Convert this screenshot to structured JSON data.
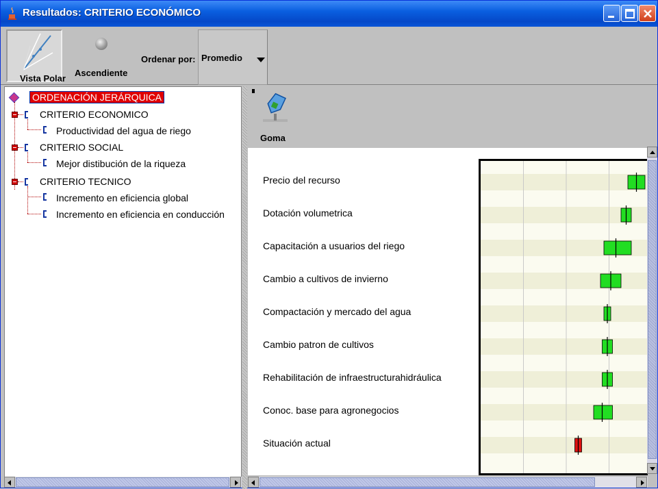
{
  "window": {
    "title": "Resultados: CRITERIO ECONÓMICO"
  },
  "toolbar": {
    "polar_view_label": "Vista Polar",
    "ascending_label": "Ascendiente",
    "order_by_label": "Ordenar por:",
    "order_by_value": "Promedio"
  },
  "tree": {
    "root": "ORDENACIÓN JERÁRQUICA",
    "criteria": [
      {
        "label": "CRITERIO ECONOMICO",
        "children": [
          "Productividad del agua de riego"
        ]
      },
      {
        "label": "CRITERIO SOCIAL",
        "children": [
          "Mejor distibución de la riqueza"
        ]
      },
      {
        "label": "CRITERIO TECNICO",
        "children": [
          "Incremento en eficiencia global",
          "Incremento en eficiencia en conducción"
        ]
      }
    ]
  },
  "results_toolbar": {
    "eraser_label": "Goma"
  },
  "chart_data": {
    "type": "box",
    "axis_range": [
      0,
      1
    ],
    "grid": true,
    "alternatives": [
      {
        "name": "Precio del recurso",
        "low": 0.86,
        "high": 0.96,
        "mid": 0.91,
        "color": "#22dd22"
      },
      {
        "name": "Dotación volumetrica",
        "low": 0.82,
        "high": 0.88,
        "mid": 0.85,
        "color": "#22dd22"
      },
      {
        "name": "Capacitación a usuarios del riego",
        "low": 0.72,
        "high": 0.88,
        "mid": 0.79,
        "color": "#22dd22"
      },
      {
        "name": "Cambio a cultivos de invierno",
        "low": 0.7,
        "high": 0.82,
        "mid": 0.76,
        "color": "#22dd22"
      },
      {
        "name": "Compactación y mercado del agua",
        "low": 0.72,
        "high": 0.76,
        "mid": 0.74,
        "color": "#22dd22"
      },
      {
        "name": "Cambio patron de cultivos",
        "low": 0.71,
        "high": 0.77,
        "mid": 0.74,
        "color": "#22dd22"
      },
      {
        "name": "Rehabilitación de infraestructurahidráulica",
        "low": 0.71,
        "high": 0.77,
        "mid": 0.74,
        "color": "#22dd22"
      },
      {
        "name": "Conoc. base para agronegocios",
        "low": 0.66,
        "high": 0.77,
        "mid": 0.71,
        "color": "#22dd22"
      },
      {
        "name": "Situación actual",
        "low": 0.55,
        "high": 0.59,
        "mid": 0.57,
        "color": "#dd1111"
      }
    ]
  }
}
